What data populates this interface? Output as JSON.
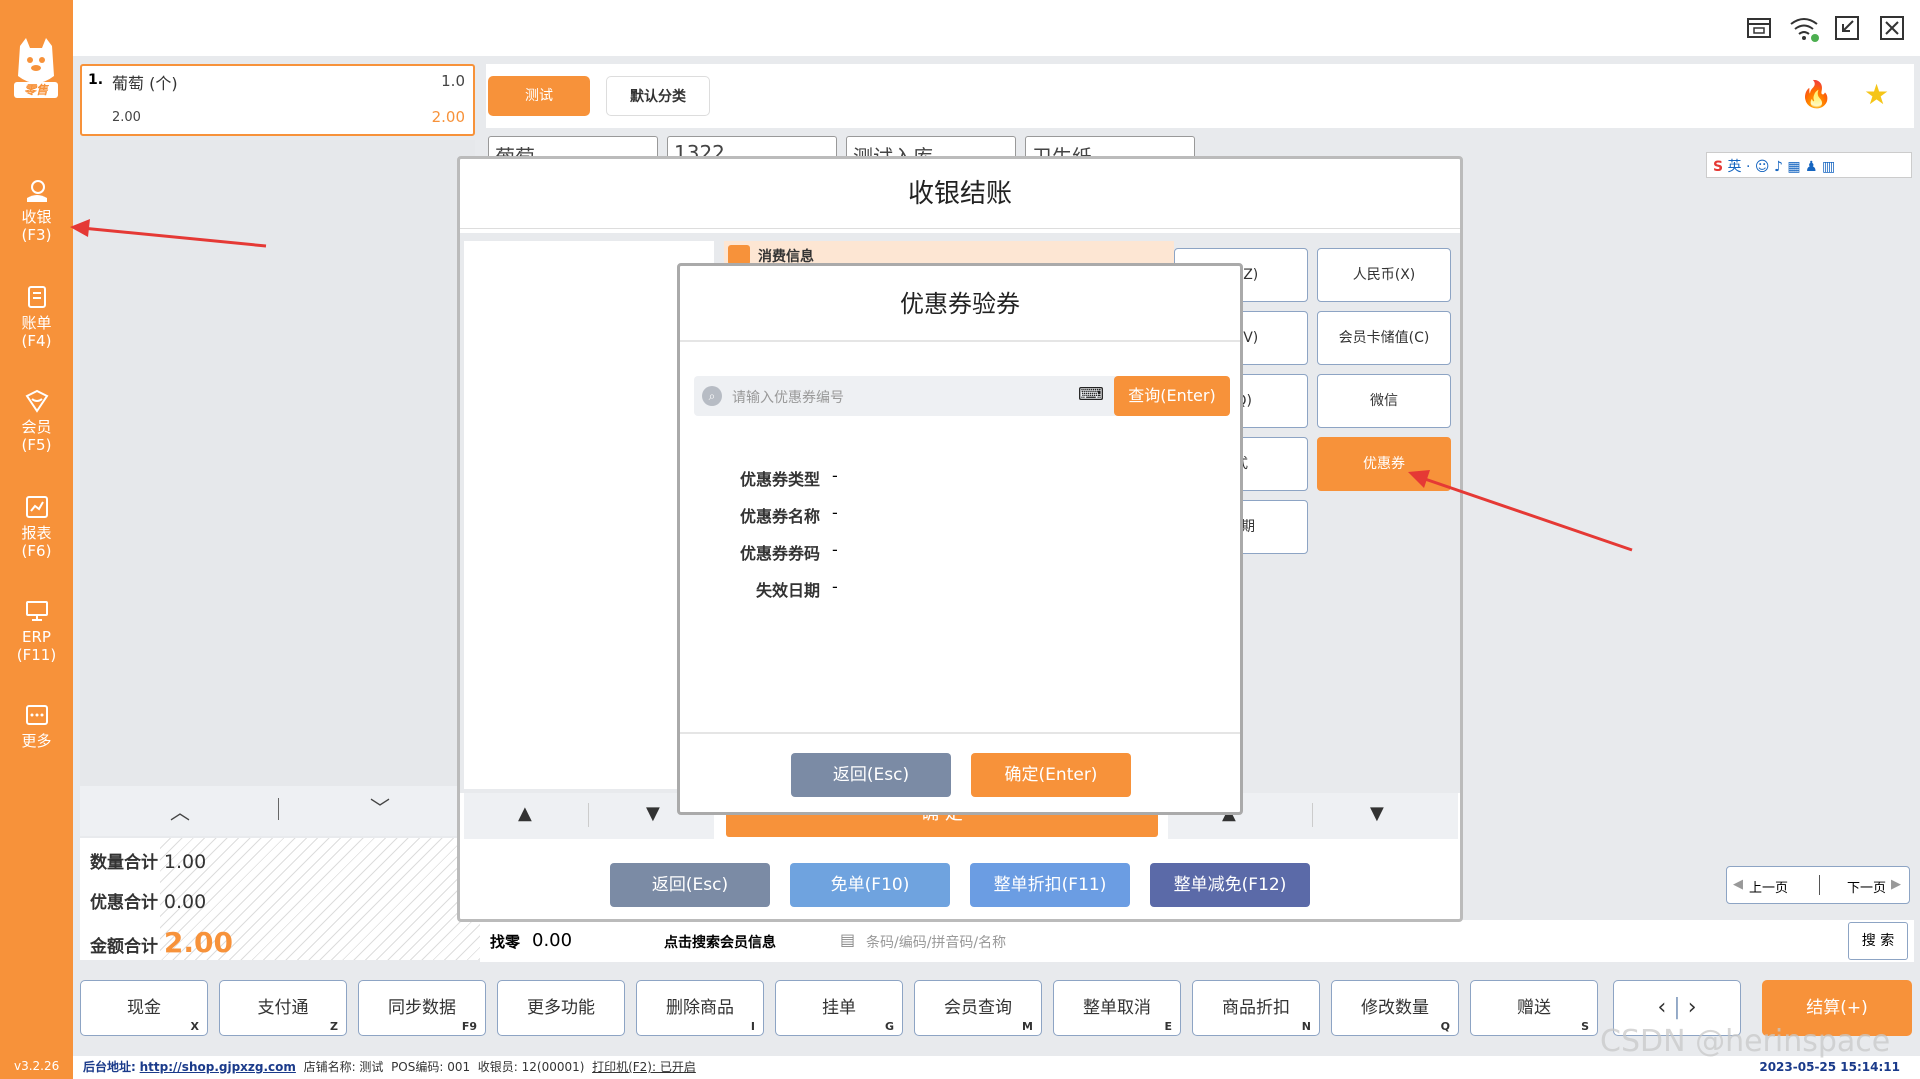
{
  "sidebar": {
    "logo_text": "零售",
    "items": [
      {
        "label": "收银",
        "key": "(F3)"
      },
      {
        "label": "账单",
        "key": "(F4)"
      },
      {
        "label": "会员",
        "key": "(F5)"
      },
      {
        "label": "报表",
        "key": "(F6)"
      },
      {
        "label": "ERP",
        "key": "(F11)"
      },
      {
        "label": "更多",
        "key": ""
      }
    ],
    "version": "v3.2.26"
  },
  "cart": {
    "item_index": "1.",
    "item_name": "葡萄 (个)",
    "item_qty": "1.0",
    "item_price": "2.00",
    "item_total": "2.00"
  },
  "summary": {
    "qty_label": "数量合计",
    "qty_value": "1.00",
    "discount_label": "优惠合计",
    "discount_value": "0.00",
    "amount_label": "金额合计",
    "amount_value": "2.00",
    "change_label": "找零",
    "change_value": "0.00",
    "member_search": "点击搜索会员信息"
  },
  "categories": [
    {
      "label": "测试",
      "active": true
    },
    {
      "label": "默认分类",
      "active": false
    }
  ],
  "products": [
    "葡萄",
    "1322",
    "测试入库",
    "卫生纸"
  ],
  "search": {
    "placeholder": "条码/编码/拼音码/名称",
    "button": "搜 索"
  },
  "pager": {
    "prev": "上一页",
    "next": "下一页"
  },
  "fkeys": [
    {
      "label": "现金",
      "key": "X"
    },
    {
      "label": "支付通",
      "key": "Z"
    },
    {
      "label": "同步数据",
      "key": "F9"
    },
    {
      "label": "更多功能",
      "key": ""
    },
    {
      "label": "删除商品",
      "key": "I"
    },
    {
      "label": "挂单",
      "key": "G"
    },
    {
      "label": "会员查询",
      "key": "M"
    },
    {
      "label": "整单取消",
      "key": "E"
    },
    {
      "label": "商品折扣",
      "key": "N"
    },
    {
      "label": "修改数量",
      "key": "Q"
    },
    {
      "label": "赠送",
      "key": "S"
    }
  ],
  "checkout_button": "结算(+)",
  "footer": {
    "backend_label": "后台地址:",
    "backend_url": "http://shop.gjpxzg.com",
    "store": "店铺名称: 测试",
    "pos": "POS编码: 001",
    "cashier": "收银员: 12(00001)",
    "printer": "打印机(F2): 已开启",
    "datetime": "2023-05-25 15:14:11",
    "watermark": "CSDN @herinspace"
  },
  "checkout_dialog": {
    "title": "收银结账",
    "consume_info": "消费信息",
    "pay_methods_left": [
      "通(Z)",
      "扣(V)",
      "(Q)",
      "式",
      "分期"
    ],
    "pay_methods_right": [
      "人民币(X)",
      "会员卡储值(C)",
      "微信",
      "优惠券"
    ],
    "confirm_partial": "确    定",
    "bottom_buttons": [
      "返回(Esc)",
      "免单(F10)",
      "整单折扣(F11)",
      "整单减免(F12)"
    ]
  },
  "coupon_dialog": {
    "title": "优惠券验券",
    "input_placeholder": "请输入优惠券编号",
    "query_button": "查询(Enter)",
    "fields": [
      {
        "label": "优惠券类型",
        "value": "-"
      },
      {
        "label": "优惠券名称",
        "value": "-"
      },
      {
        "label": "优惠券券码",
        "value": "-"
      },
      {
        "label": "失效日期",
        "value": "-"
      }
    ],
    "back_button": "返回(Esc)",
    "confirm_button": "确定(Enter)"
  },
  "ime_bar": {
    "lang": "英"
  },
  "colors": {
    "brand": "#f7923a",
    "danger": "#e53935",
    "slate": "#7b8ba5",
    "blue": "#6fa3df",
    "indigo": "#5b6aa8"
  }
}
